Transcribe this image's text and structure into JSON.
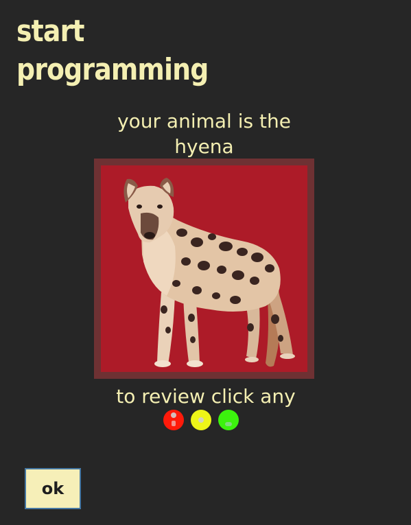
{
  "title": {
    "line1": "start",
    "line2": "programming"
  },
  "prompt": {
    "line1": "your animal is the",
    "line2": "hyena"
  },
  "animal": {
    "name": "hyena",
    "icon": "hyena-image"
  },
  "review": {
    "text": "to review click any"
  },
  "review_dots": [
    {
      "name": "red-dot",
      "color": "#ff1a0a"
    },
    {
      "name": "yellow-dot",
      "color": "#eef518"
    },
    {
      "name": "green-dot",
      "color": "#3cf20e"
    }
  ],
  "ok_button": {
    "label": "ok"
  },
  "colors": {
    "background": "#262626",
    "text": "#f4efb2",
    "image_border": "#6e3133",
    "image_background": "#ad1b28",
    "button_background": "#f6efb8",
    "button_border": "#4577a3"
  }
}
